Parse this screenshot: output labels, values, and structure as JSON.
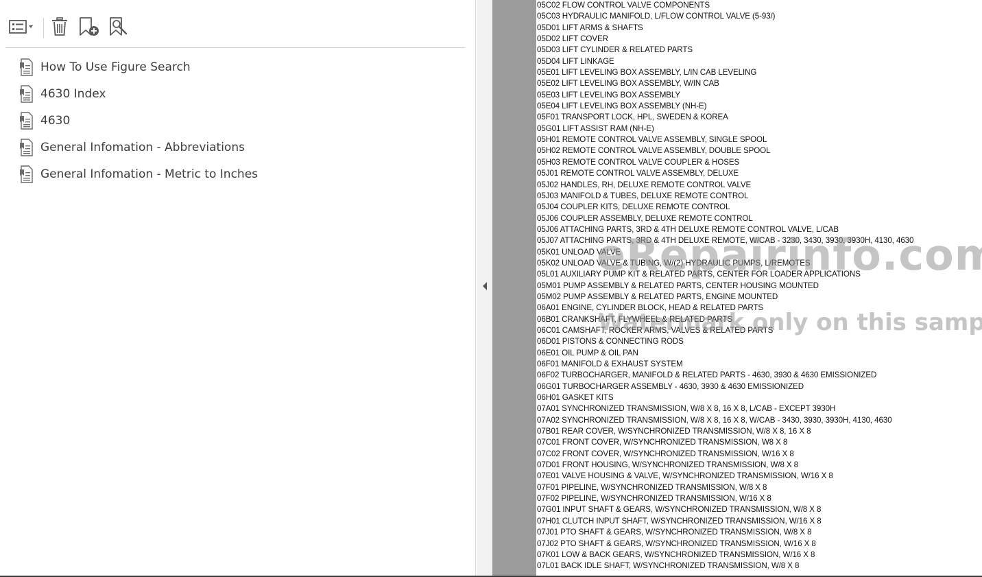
{
  "toolbar": {
    "icons": [
      "options-menu-icon",
      "delete-bookmark-icon",
      "new-bookmark-icon",
      "find-bookmark-icon"
    ]
  },
  "bookmarks": [
    {
      "label": "How To Use Figure Search"
    },
    {
      "label": "4630 Index"
    },
    {
      "label": "4630"
    },
    {
      "label": "General Infomation - Abbreviations"
    },
    {
      "label": "General Infomation - Metric to Inches"
    }
  ],
  "document": {
    "lines": [
      "05C02 FLOW CONTROL VALVE COMPONENTS",
      "05C03 HYDRAULIC MANIFOLD, L/FLOW CONTROL VALVE (5-93/)",
      "05D01 LIFT ARMS & SHAFTS",
      "05D02 LIFT COVER",
      "05D03 LIFT CYLINDER & RELATED PARTS",
      "05D04 LIFT LINKAGE",
      "05E01 LIFT LEVELING BOX ASSEMBLY, L/IN CAB LEVELING",
      "05E02 LIFT LEVELING BOX ASSEMBLY, W/IN CAB",
      "05E03 LIFT LEVELING BOX ASSEMBLY",
      "05E04 LIFT LEVELING BOX ASSEMBLY (NH-E)",
      "05F01 TRANSPORT LOCK, HPL, SWEDEN & KOREA",
      "05G01 LIFT ASSIST RAM (NH-E)",
      "05H01 REMOTE CONTROL VALVE ASSEMBLY, SINGLE SPOOL",
      "05H02 REMOTE CONTROL VALVE ASSEMBLY, DOUBLE SPOOL",
      "05H03 REMOTE CONTROL VALVE COUPLER & HOSES",
      "05J01 REMOTE CONTROL VALVE ASSEMBLY, DELUXE",
      "05J02 HANDLES, RH, DELUXE REMOTE CONTROL VALVE",
      "05J03 MANIFOLD & TUBES, DELUXE REMOTE CONTROL",
      "05J04 COUPLER KITS, DELUXE REMOTE CONTROL",
      "05J06 COUPLER ASSEMBLY, DELUXE REMOTE CONTROL",
      "05J06 ATTACHING PARTS, 3RD & 4TH DELUXE REMOTE CONTROL VALVE, L/CAB",
      "05J07 ATTACHING PARTS, 3RD & 4TH DELUXE REMOTE, W/CAB - 3230, 3430, 3930, 3930H, 4130, 4630",
      "05K01 UNLOAD VALVE",
      "05K02 UNLOAD VALVE & TUBING, W/(2) HYDRAULIC PUMPS, L/REMOTES",
      "05L01 AUXILIARY PUMP KIT & RELATED PARTS, CENTER FOR LOADER APPLICATIONS",
      "05M01 PUMP ASSEMBLY & RELATED PARTS, CENTER HOUSING MOUNTED",
      "05M02 PUMP ASSEMBLY & RELATED PARTS, ENGINE MOUNTED",
      "06A01 ENGINE, CYLINDER BLOCK, HEAD & RELATED PARTS",
      "06B01 CRANKSHAFT, FLYWHEEL & RELATED PARTS",
      "06C01 CAMSHAFT, ROCKER ARMS, VALVES & RELATED PARTS",
      "06D01 PISTONS & CONNECTING RODS",
      "06E01 OIL PUMP & OIL PAN",
      "06F01 MANIFOLD & EXHAUST SYSTEM",
      "06F02 TURBOCHARGER, MANIFOLD & RELATED PARTS - 4630, 3930 & 4630 EMISSIONIZED",
      "06G01 TURBOCHARGER ASSEMBLY - 4630, 3930 & 4630 EMISSIONIZED",
      "06H01 GASKET KITS",
      "07A01 SYNCHRONIZED TRANSMISSION, W/8 X 8, 16 X 8, L/CAB - EXCEPT 3930H",
      "07A02 SYNCHRONIZED TRANSMISSION, W/8 X 8, 16 X 8, W/CAB - 3430, 3930, 3930H, 4130, 4630",
      "07B01 REAR COVER, W/SYNCHRONIZED TRANSMISSION, W/8 X 8, 16 X 8",
      "07C01 FRONT COVER, W/SYNCHRONIZED TRANSMISSION, W8 X 8",
      "07C02 FRONT COVER, W/SYNCHRONIZED TRANSMISSION, W/16 X 8",
      "07D01 FRONT HOUSING, W/SYNCHRONIZED TRANSMISSION, W/8 X 8",
      "07E01 VALVE HOUSING & VALVE, W/SYNCHRONIZED TRANSMISSION, W/16 X 8",
      "07F01 PIPELINE, W/SYNCHRONIZED TRANSMISSION, W/8 X 8",
      "07F02 PIPELINE, W/SYNCHRONIZED TRANSMISSION, W/16 X 8",
      "07G01 INPUT SHAFT & GEARS, W/SYNCHRONIZED TRANSMISSION, W/8 X 8",
      "07H01 CLUTCH INPUT SHAFT, W/SYNCHRONIZED TRANSMISSION, W/16 X 8",
      "07J01 PTO SHAFT & GEARS, W/SYNCHRONIZED TRANSMISSION, W/8 X 8",
      "07J02 PTO SHAFT & GEARS, W/SYNCHRONIZED TRANSMISSION, W/16 X 8",
      "07K01 LOW & BACK GEARS, W/SYNCHRONIZED TRANSMISSION, W/16 X 8",
      "07L01 BACK IDLE SHAFT, W/SYNCHRONIZED TRANSMISSION, W/8 X 8"
    ]
  },
  "watermark": {
    "line1": "eRepairinfo.com",
    "line2": "Watermark only on this sample"
  },
  "colors": {
    "gutter": "#9b9b9b",
    "icon": "#5a5a5a",
    "bookmark_text": "#3d3d3d"
  }
}
